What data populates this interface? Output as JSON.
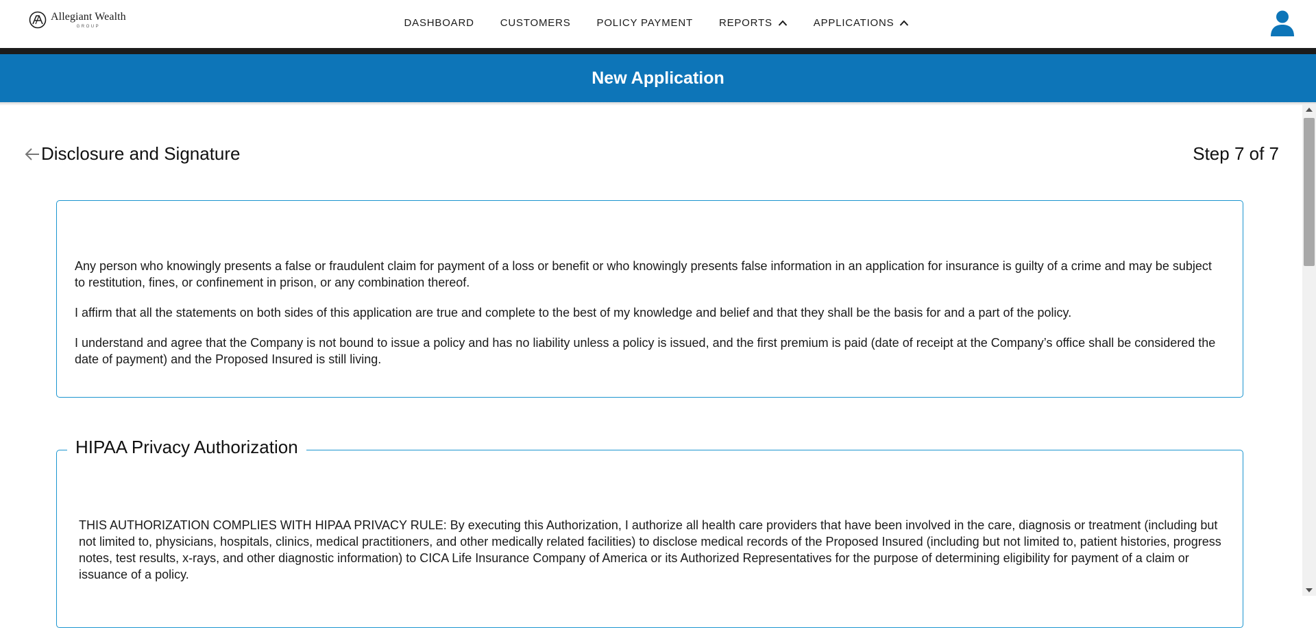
{
  "brand": {
    "name": "Allegiant Wealth",
    "sub": "GROUP"
  },
  "nav": {
    "items": [
      {
        "label": "DASHBOARD"
      },
      {
        "label": "CUSTOMERS"
      },
      {
        "label": "POLICY PAYMENT"
      },
      {
        "label": "REPORTS",
        "icon": "chevron-up-icon"
      },
      {
        "label": "APPLICATIONS",
        "icon": "chevron-up-icon"
      }
    ],
    "user_icon": "user-icon"
  },
  "banner": {
    "title": "New Application"
  },
  "step": {
    "title": "Disclosure and Signature",
    "progress": "Step 7 of 7",
    "current": 7,
    "total": 7
  },
  "disclosure": {
    "paragraphs": [
      "Any person who knowingly presents a false or fraudulent claim for payment of a loss or benefit or who knowingly presents false information in an application for insurance is guilty of a crime and may be subject to restitution, fines, or confinement in prison, or any combination thereof.",
      "I affirm that all the statements on both sides of this application are true and complete to the best of my knowledge and belief and that they shall be the basis for and a part of the policy.",
      "I understand and agree that the Company is not bound to issue a policy and has no liability unless a policy is issued, and the first premium is paid (date of receipt at the Company’s office shall be considered the date of payment) and the Proposed Insured is still living."
    ]
  },
  "hipaa": {
    "title": "HIPAA Privacy Authorization",
    "text": "THIS AUTHORIZATION COMPLIES WITH HIPAA PRIVACY RULE: By executing this Authorization, I authorize all health care providers that have been involved in the care, diagnosis or treatment (including but not limited to, physicians, hospitals, clinics, medical practitioners, and other medically related facilities) to disclose medical records of the Proposed Insured (including but not limited to, patient histories, progress notes, test results, x-rays, and other diagnostic information) to CICA Life Insurance Company of America or its Authorized Representatives for the purpose of determining eligibility for payment of a claim or issuance of a policy."
  },
  "colors": {
    "primary": "#0d75b8",
    "border": "#1a94cf",
    "nav_bar": "#1c1c1c"
  }
}
